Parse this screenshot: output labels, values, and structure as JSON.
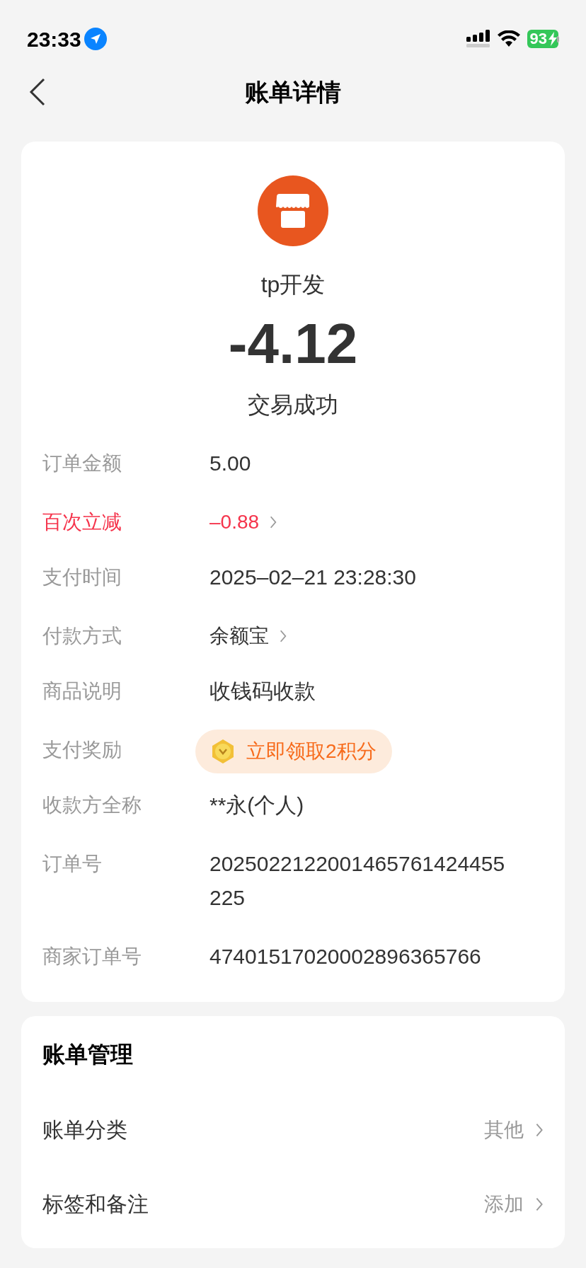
{
  "status_bar": {
    "time": "23:33",
    "battery": "93"
  },
  "header": {
    "title": "账单详情"
  },
  "summary": {
    "merchant": "tp开发",
    "amount": "-4.12",
    "status": "交易成功"
  },
  "details": [
    {
      "label": "订单金额",
      "value": "5.00",
      "kind": "text"
    },
    {
      "label": "百次立减",
      "value": "–0.88",
      "kind": "discount"
    },
    {
      "label": "支付时间",
      "value": "2025–02–21 23:28:30",
      "kind": "text"
    },
    {
      "label": "付款方式",
      "value": "余额宝",
      "kind": "link"
    },
    {
      "label": "商品说明",
      "value": "收钱码收款",
      "kind": "text"
    },
    {
      "label": "支付奖励",
      "value": "立即领取2积分",
      "kind": "reward"
    },
    {
      "label": "收款方全称",
      "value": "**永(个人)",
      "kind": "text"
    },
    {
      "label": "订单号",
      "value": "2025022122001465761424455225",
      "kind": "text"
    },
    {
      "label": "商家订单号",
      "value": "47401517020002896365766",
      "kind": "text"
    }
  ],
  "management": {
    "title": "账单管理",
    "items": [
      {
        "label": "账单分类",
        "value": "其他"
      },
      {
        "label": "标签和备注",
        "value": "添加"
      }
    ]
  }
}
